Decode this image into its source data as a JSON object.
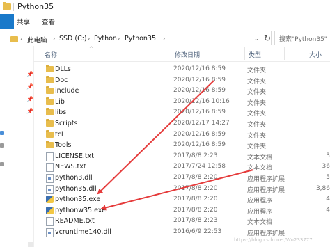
{
  "window": {
    "title": "Python35"
  },
  "ribbon": {
    "share_label": "共享",
    "view_label": "查看"
  },
  "address": {
    "crumbs": [
      "此电脑",
      "SSD (C:)",
      "Python",
      "Python35"
    ],
    "search_placeholder": "搜索\"Python35\""
  },
  "columns": {
    "name": "名称",
    "date": "修改日期",
    "type": "类型",
    "size": "大小"
  },
  "files": [
    {
      "name": "DLLs",
      "date": "2020/12/16 8:59",
      "type": "文件夹",
      "size": "",
      "icon": "folder"
    },
    {
      "name": "Doc",
      "date": "2020/12/16 8:59",
      "type": "文件夹",
      "size": "",
      "icon": "folder"
    },
    {
      "name": "include",
      "date": "2020/12/16 8:59",
      "type": "文件夹",
      "size": "",
      "icon": "folder"
    },
    {
      "name": "Lib",
      "date": "2020/12/16 10:16",
      "type": "文件夹",
      "size": "",
      "icon": "folder"
    },
    {
      "name": "libs",
      "date": "2020/12/16 8:59",
      "type": "文件夹",
      "size": "",
      "icon": "folder"
    },
    {
      "name": "Scripts",
      "date": "2020/12/17 14:27",
      "type": "文件夹",
      "size": "",
      "icon": "folder"
    },
    {
      "name": "tcl",
      "date": "2020/12/16 8:59",
      "type": "文件夹",
      "size": "",
      "icon": "folder"
    },
    {
      "name": "Tools",
      "date": "2020/12/16 8:59",
      "type": "文件夹",
      "size": "",
      "icon": "folder"
    },
    {
      "name": "LICENSE.txt",
      "date": "2017/8/8 2:23",
      "type": "文本文档",
      "size": "3",
      "icon": "doc"
    },
    {
      "name": "NEWS.txt",
      "date": "2017/7/24 12:58",
      "type": "文本文档",
      "size": "36",
      "icon": "doc"
    },
    {
      "name": "python3.dll",
      "date": "2017/8/8 2:20",
      "type": "应用程序扩展",
      "size": "5",
      "icon": "dll"
    },
    {
      "name": "python35.dll",
      "date": "2017/8/8 2:20",
      "type": "应用程序扩展",
      "size": "3,86",
      "icon": "dll"
    },
    {
      "name": "python35.exe",
      "date": "2017/8/8 2:20",
      "type": "应用程序",
      "size": "4",
      "icon": "py"
    },
    {
      "name": "pythonw35.exe",
      "date": "2017/8/8 2:20",
      "type": "应用程序",
      "size": "4",
      "icon": "py"
    },
    {
      "name": "README.txt",
      "date": "2017/8/8 2:23",
      "type": "文本文档",
      "size": "",
      "icon": "doc"
    },
    {
      "name": "vcruntime140.dll",
      "date": "2016/6/9 22:53",
      "type": "应用程序扩展",
      "size": "",
      "icon": "dll"
    }
  ],
  "watermark": "https://blog.csdn.net/Wu233777",
  "colors": {
    "folder": "#e8bd4d",
    "accent": "#1979ca",
    "arrow": "#e53b3b"
  }
}
